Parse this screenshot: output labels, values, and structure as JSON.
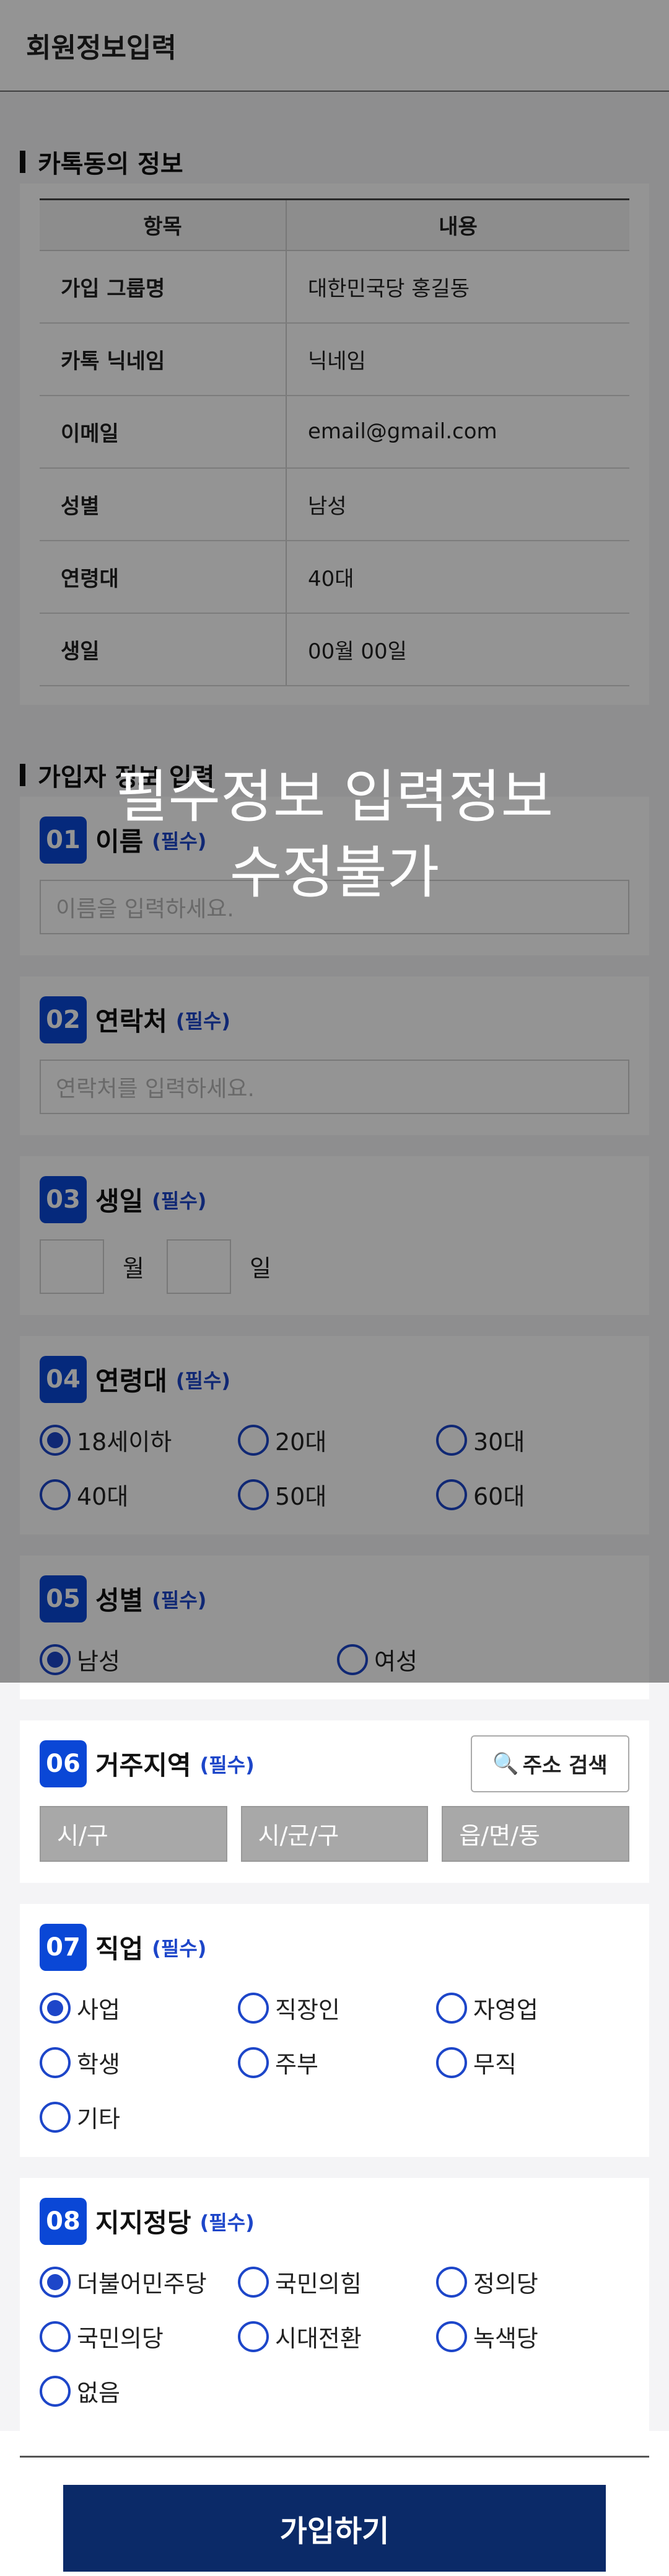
{
  "header": {
    "title": "회원정보입력"
  },
  "kakao_section": {
    "title": "카톡동의 정보",
    "columns": [
      "항목",
      "내용"
    ],
    "rows": [
      [
        "가입 그룹명",
        "대한민국당 홍길동"
      ],
      [
        "카톡 닉네임",
        "닉네임"
      ],
      [
        "이메일",
        "email@gmail.com"
      ],
      [
        "성별",
        "남성"
      ],
      [
        "연령대",
        "40대"
      ],
      [
        "생일",
        "00월 00일"
      ]
    ]
  },
  "member_section": {
    "title": "가입자 정보 입력"
  },
  "required_label": "(필수)",
  "q1": {
    "num": "01",
    "title": "이름",
    "placeholder": "이름을 입력하세요."
  },
  "q2": {
    "num": "02",
    "title": "연락처",
    "placeholder": "연락처를 입력하세요."
  },
  "q3": {
    "num": "03",
    "title": "생일",
    "month_label": "월",
    "day_label": "일"
  },
  "q4": {
    "num": "04",
    "title": "연령대",
    "options": [
      "18세이하",
      "20대",
      "30대",
      "40대",
      "50대",
      "60대"
    ],
    "selected": "18세이하"
  },
  "q5": {
    "num": "05",
    "title": "성별",
    "options": [
      "남성",
      "여성"
    ],
    "selected": "남성"
  },
  "q6": {
    "num": "06",
    "title": "거주지역",
    "search_label": "주소 검색",
    "fields": [
      "시/구",
      "시/군/구",
      "읍/면/동"
    ]
  },
  "q7": {
    "num": "07",
    "title": "직업",
    "options": [
      "사업",
      "직장인",
      "자영업",
      "학생",
      "주부",
      "무직",
      "기타"
    ],
    "selected": "사업"
  },
  "q8": {
    "num": "08",
    "title": "지지정당",
    "options": [
      "더불어민주당",
      "국민의힘",
      "정의당",
      "국민의당",
      "시대전환",
      "녹색당",
      "없음"
    ],
    "selected": "더불어민주당"
  },
  "submit": {
    "label": "가입하기"
  },
  "overlay": {
    "line1": "필수정보 입력정보",
    "line2": "수정불가"
  },
  "colors": {
    "accent": "#0a47d6",
    "submit_bg": "#0b2a68",
    "overlay": "rgba(0,0,0,0.42)"
  },
  "icons": {
    "search": "magnifier-icon",
    "radio_on": "radio-selected-icon",
    "radio_off": "radio-unselected-icon"
  }
}
